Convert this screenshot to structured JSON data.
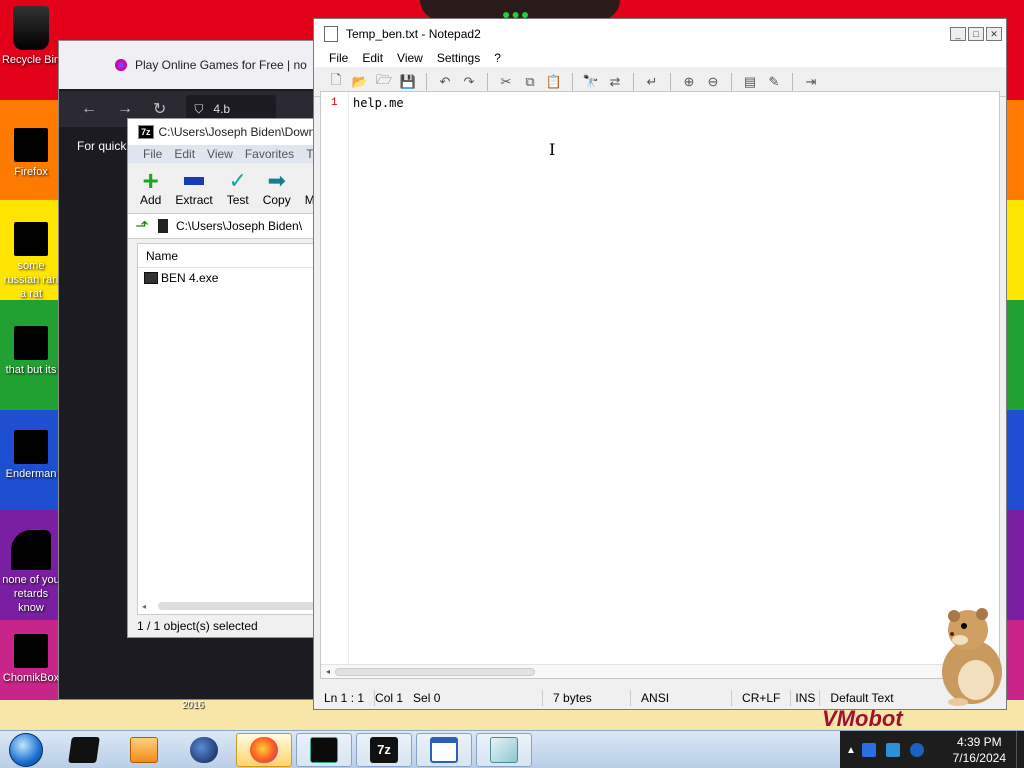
{
  "desktop": {
    "icons": [
      {
        "label": "Recycle Bin"
      },
      {
        "label": "Firefox"
      },
      {
        "label": "some russian ran a rat"
      },
      {
        "label": "that but its"
      },
      {
        "label": "Enderman"
      },
      {
        "label": "none of you retards know"
      },
      {
        "label": "ChomikBox"
      }
    ],
    "wallpaper_text": "VMobot",
    "wallpaper_year": "2016"
  },
  "browser": {
    "tab_title": "Play Online Games for Free | no",
    "url_fragment": "4.b",
    "notice_text": "For quick"
  },
  "zip": {
    "title": "C:\\Users\\Joseph Biden\\Downloads",
    "badge": "7z",
    "menu": [
      "File",
      "Edit",
      "View",
      "Favorites",
      "T"
    ],
    "toolbar": [
      {
        "label": "Add",
        "icon": "add-icon"
      },
      {
        "label": "Extract",
        "icon": "extract-icon"
      },
      {
        "label": "Test",
        "icon": "test-icon"
      },
      {
        "label": "Copy",
        "icon": "copy-icon"
      },
      {
        "label": "M",
        "icon": "move-icon"
      }
    ],
    "path": "C:\\Users\\Joseph Biden\\",
    "column_name": "Name",
    "rows": [
      {
        "name": "BEN 4.exe"
      }
    ],
    "status": "1 / 1 object(s) selected"
  },
  "notepad": {
    "title": "Temp_ben.txt - Notepad2",
    "menu": [
      "File",
      "Edit",
      "View",
      "Settings",
      "?"
    ],
    "line_number": "1",
    "content": "help.me",
    "cursor_glyph": "I",
    "status": {
      "position": "Ln 1 : 1",
      "column": "Col 1",
      "selection": "Sel 0",
      "size": "7 bytes",
      "encoding": "ANSI",
      "line_endings": "CR+LF",
      "insert_mode": "INS",
      "scheme": "Default Text"
    }
  },
  "taskbar": {
    "clock_time": "4:39 PM",
    "clock_date": "7/16/2024",
    "running_badge": "7z"
  }
}
